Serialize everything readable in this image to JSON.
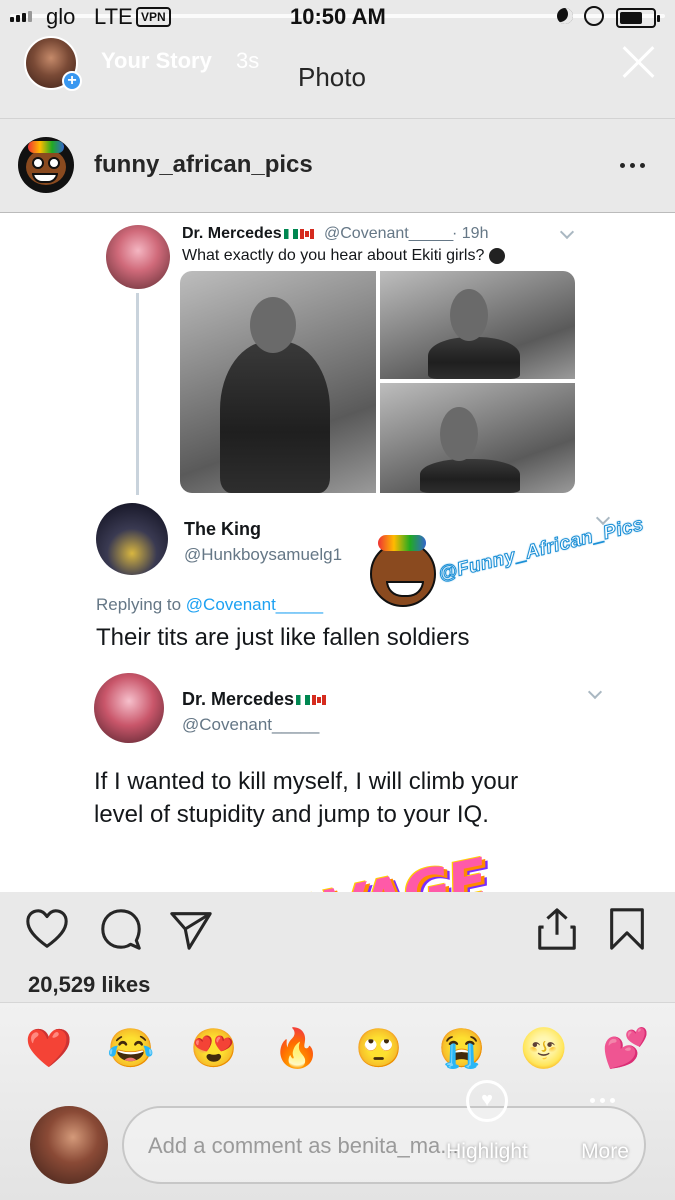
{
  "status_bar": {
    "carrier": "glo",
    "network": "LTE",
    "vpn": "VPN",
    "time": "10:50 AM"
  },
  "story": {
    "label": "Your Story",
    "age": "3s",
    "title": "Photo"
  },
  "post": {
    "username": "funny_african_pics",
    "likes": "20,529 likes"
  },
  "tweet_image": {
    "tweet1": {
      "name": "Dr. Mercedes",
      "handle": "@Covenant_____",
      "time": "· 19h",
      "text": "What exactly do you hear about Ekiti girls?"
    },
    "tweet2": {
      "name": "The King",
      "handle": "@Hunkboysamuelg1",
      "replying_prefix": "Replying to ",
      "replying_to": "@Covenant_____",
      "text": "Their tits are just like fallen soldiers"
    },
    "tweet3": {
      "name": "Dr. Mercedes",
      "handle": "@Covenant_____",
      "text": "If I wanted to kill myself, I will climb your level of stupidity and jump to your IQ."
    },
    "watermark": "@Funny_African_Pics",
    "sticker": "SAVAGE"
  },
  "reactions": {
    "emojis": [
      "❤️",
      "😂",
      "😍",
      "🔥",
      "🙄",
      "😭",
      "🌝",
      "💕"
    ]
  },
  "comment": {
    "placeholder": "Add a comment as benita_ma..."
  },
  "actions": {
    "highlight_label": "Highlight",
    "more_label": "More"
  },
  "colors": {
    "twitter_link": "#1da1f2",
    "instagram_blue": "#3897f0"
  }
}
